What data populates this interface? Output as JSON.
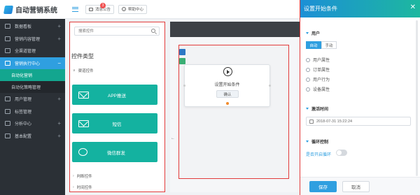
{
  "brand": {
    "name": "自动营销系统"
  },
  "sidebar": {
    "items": [
      {
        "label": "数据看板",
        "active": false
      },
      {
        "label": "营销内容管理",
        "active": false
      },
      {
        "label": "全渠道管理",
        "active": false
      },
      {
        "label": "营销执行中心",
        "active": true
      },
      {
        "label": "用户管理",
        "active": false
      },
      {
        "label": "标签管理",
        "active": false
      },
      {
        "label": "分析中心",
        "active": false
      },
      {
        "label": "基本配置",
        "active": false
      }
    ],
    "subitems": [
      {
        "label": "自动化营销",
        "active": true
      },
      {
        "label": "自动化策略管理",
        "active": false
      }
    ]
  },
  "header": {
    "messages_label": "消息公告",
    "messages_count": "3",
    "help_label": "帮助中心"
  },
  "widget_panel": {
    "search_placeholder": "搜索控件",
    "title": "控件类型",
    "groups": {
      "channel": "渠道控件",
      "judge": "判断控件",
      "time": "时间控件"
    },
    "cards": [
      {
        "label": "APP推送",
        "icon": "mail-icon"
      },
      {
        "label": "短信",
        "icon": "message-icon"
      },
      {
        "label": "微信群发",
        "icon": "wechat-icon"
      }
    ]
  },
  "canvas": {
    "node_title": "设置开始条件",
    "node_button": "确认"
  },
  "drawer": {
    "title": "设置开始条件",
    "section_user": "用户",
    "mode_options": [
      "自动",
      "手动"
    ],
    "mode_selected": "自动",
    "attributes": [
      "用户属性",
      "订单属性",
      "用户行为",
      "设备属性"
    ],
    "section_time": "激活时间",
    "activation_time": "2018-07-31 15:22:24",
    "section_loop": "循环控制",
    "loop_label": "是否开启循环",
    "loop_enabled": false,
    "save_label": "保存",
    "cancel_label": "取消"
  }
}
